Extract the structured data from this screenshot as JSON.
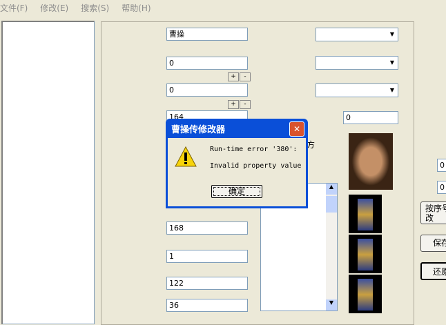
{
  "menu": [
    "文件(F)",
    "修改(E)",
    "搜索(S)",
    "帮助(H)"
  ],
  "fields": {
    "name": "曹操",
    "f1": "0",
    "f2": "0",
    "f3": "164",
    "f4": "168",
    "f5": "1",
    "f6": "122",
    "f7": "36",
    "right_val": "0",
    "side1": "0",
    "side2": "0"
  },
  "pm": {
    "plus": "+",
    "minus": "-"
  },
  "label_side": "我方",
  "buttons": {
    "modify_by_order": "按序号修改",
    "save": "保存",
    "restore": "还原"
  },
  "dialog": {
    "title": "曹操传修改器",
    "line1": "Run-time error '380':",
    "line2": "Invalid property value",
    "ok": "确定",
    "close": "✕"
  }
}
